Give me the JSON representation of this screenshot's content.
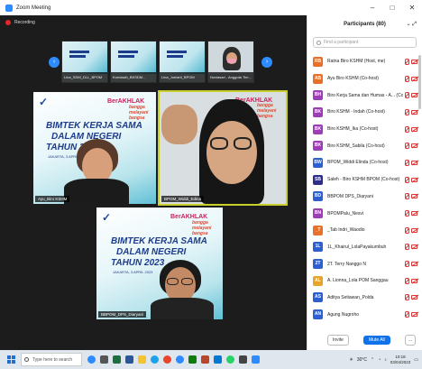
{
  "window": {
    "title": "Zoom Meeting",
    "controls": [
      "–",
      "□",
      "✕"
    ]
  },
  "recording": {
    "label": "Recording"
  },
  "thumbnails": [
    {
      "label": "Lina_SDM_DLL_BPOM"
    },
    {
      "label": "Kurniasih_BKSDM..."
    },
    {
      "label": "Lina_Juniarti_BPOM"
    },
    {
      "label": "Noviasari - Anggota Tim..."
    }
  ],
  "slide": {
    "title_line1": "BIMTEK KERJA SAMA",
    "title_line2": "DALAM NEGERI",
    "title_line3": "TAHUN 2023",
    "date": "JAKARTA, 3 APRIL 2023",
    "berakhlak": "BerAKHLAK",
    "bangga": "bangga melayani bangsa"
  },
  "tiles": [
    {
      "name": "Ayu_Biro KSHM"
    },
    {
      "name": "BPOM_Widdi_Edina"
    },
    {
      "name": "BBPOM_DPS_Diaryani"
    }
  ],
  "participants": {
    "header": "Participants (80)",
    "search_placeholder": "Find a participant",
    "items": [
      {
        "initials": "RB",
        "name": "Ratna Biro KSHM (Host, me)",
        "color": "#e8702a"
      },
      {
        "initials": "AB",
        "name": "Ayu Biro KSHM (Co-host)",
        "color": "#e8702a"
      },
      {
        "initials": "BH",
        "name": "Biro Kerja Sama dan Humas - A... (Co-host)",
        "color": "#9c3fb5"
      },
      {
        "initials": "BK",
        "name": "Biro KSHM - Indah (Co-host)",
        "color": "#9c3fb5"
      },
      {
        "initials": "BK",
        "name": "Biro KSHM_Ika (Co-host)",
        "color": "#9c3fb5"
      },
      {
        "initials": "BK",
        "name": "Biro KSHM_Sabila (Co-host)",
        "color": "#9c3fb5"
      },
      {
        "initials": "BW",
        "name": "BPOM_Widdi Elinda (Co-host)",
        "color": "#2d5fd0"
      },
      {
        "initials": "SB",
        "name": "Saleh - Biro KSHM BPOM (Co-host)",
        "color": "#2d2d8a"
      },
      {
        "initials": "BD",
        "name": "BBPOM DPS_Diaryani",
        "color": "#2d5fd0"
      },
      {
        "initials": "BN",
        "name": "BPOMPalu_Nesvi",
        "color": "#9c3fb5"
      },
      {
        "initials": "_T",
        "name": "_Tab Indri_Waodio",
        "color": "#e8702a"
      },
      {
        "initials": "1L",
        "name": "1L_Khairul_LolaPayakumbuh",
        "color": "#2d5fd0"
      },
      {
        "initials": "2T",
        "name": "2T. Terry Nanggo N",
        "color": "#2d5fd0"
      },
      {
        "initials": "AL",
        "name": "A. Lionna_Lola POM Sanggau",
        "color": "#e8a32a"
      },
      {
        "initials": "AS",
        "name": "Aditya Setiawan_Polda",
        "color": "#2d5fd0"
      },
      {
        "initials": "AN",
        "name": "Agung Nugroho",
        "color": "#2d5fd0"
      }
    ],
    "invite_label": "Invite",
    "mute_all_label": "Mute All",
    "more_label": "..."
  },
  "taskbar": {
    "search_placeholder": "Type here to search",
    "temperature": "30°C",
    "time": "10:18",
    "date": "03/04/2023"
  },
  "colors": {
    "accent": "#2d8cff",
    "active_speaker": "#c7d02b",
    "mute": "#d33333"
  }
}
